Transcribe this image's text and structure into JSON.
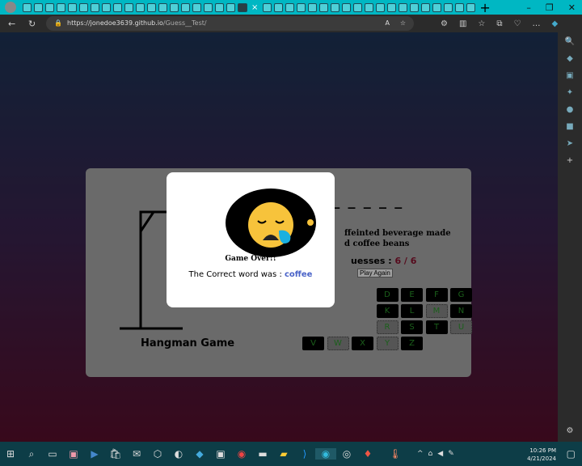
{
  "browser": {
    "url_host": "https://jonedoe3639.github.io",
    "url_path": "/Guess__Test/",
    "close_tab": "×",
    "new_tab": "+"
  },
  "game": {
    "word_display": "c _ _ _ _ _",
    "hint": "...ffeinted beverage made ...d coffee beans",
    "hint_line1": "ffeinted beverage made",
    "hint_line2": "d coffee beans",
    "guesses_label": "uesses : ",
    "guesses_value": "6 / 6",
    "play_again": "Play Again",
    "title": "Hangman Game",
    "keys": [
      {
        "l": "D",
        "c": 4,
        "used": false
      },
      {
        "l": "E",
        "c": 5,
        "used": false
      },
      {
        "l": "F",
        "c": 6,
        "used": false
      },
      {
        "l": "G",
        "c": 7,
        "used": false
      },
      {
        "l": "K",
        "c": 4,
        "used": false
      },
      {
        "l": "L",
        "c": 5,
        "used": false
      },
      {
        "l": "M",
        "c": 6,
        "used": true
      },
      {
        "l": "N",
        "c": 7,
        "used": false
      },
      {
        "l": "R",
        "c": 4,
        "used": true
      },
      {
        "l": "S",
        "c": 5,
        "used": false
      },
      {
        "l": "T",
        "c": 6,
        "used": false
      },
      {
        "l": "U",
        "c": 7,
        "used": true
      },
      {
        "l": "V",
        "c": 1,
        "used": false
      },
      {
        "l": "W",
        "c": 2,
        "used": true
      },
      {
        "l": "X",
        "c": 3,
        "used": false
      },
      {
        "l": "Y",
        "c": 4,
        "used": true
      },
      {
        "l": "Z",
        "c": 5,
        "used": false
      }
    ]
  },
  "modal": {
    "heading": "Game Over!!",
    "text": "The Correct word was : ",
    "word": "coffee",
    "icon": "sad-face-emoji"
  },
  "taskbar": {
    "time": "10:26 PM",
    "date": "4/21/2024"
  },
  "colors": {
    "accent": "#00b7c3",
    "word": "#4a63c8",
    "guesses": "#8c1230"
  }
}
